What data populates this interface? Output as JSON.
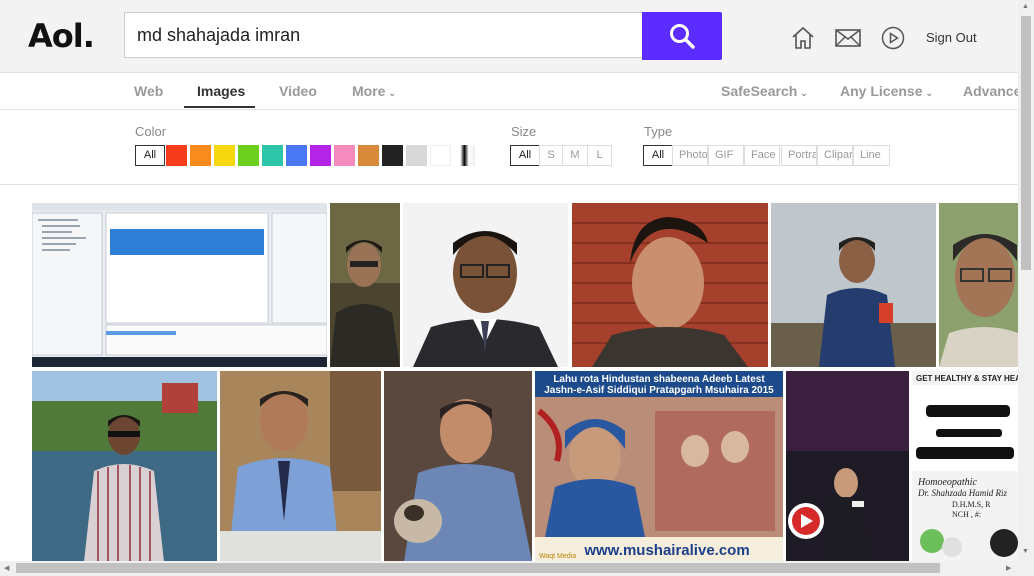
{
  "header": {
    "logo": "Aol.",
    "search_value": "md shahajada imran",
    "signout_label": "Sign Out",
    "icons": [
      "home-icon",
      "mail-icon",
      "play-icon"
    ],
    "accent_color": "#5b2bff"
  },
  "tabs": {
    "web": "Web",
    "images": "Images",
    "video": "Video",
    "more": "More",
    "safesearch": "SafeSearch",
    "license": "Any License",
    "advanced": "Advanced",
    "active": "Images"
  },
  "filters": {
    "color_label": "Color",
    "color_all": "All",
    "colors": [
      "#f53d1b",
      "#f78c1d",
      "#f5d80f",
      "#6dd01f",
      "#2ec6a8",
      "#4a78f5",
      "#b424e6",
      "#f58bbd",
      "#d88a3a",
      "#222222",
      "#d8d8d8",
      "#ffffff",
      "gradient"
    ],
    "size_label": "Size",
    "sizes": [
      "All",
      "S",
      "M",
      "L"
    ],
    "type_label": "Type",
    "types": [
      "All",
      "Photo",
      "GIF",
      "Face",
      "Portrait",
      "Clipart",
      "Line"
    ]
  },
  "results": {
    "row1": [
      "screenshot-ide",
      "man-portrait-dark",
      "man-glasses-suit",
      "man-brick-wall",
      "man-sky-jacket",
      "man-glasses-smile"
    ],
    "row2": [
      "man-lake",
      "man-blue-shirt-desk",
      "man-cat-sofa",
      "mushaira-poster",
      "man-speaker-stage",
      "homeopathic-ad"
    ],
    "mushaira_title_1": "Lahu rota Hindustan shabeena Adeeb Latest",
    "mushaira_title_2": "Jashn-e-Asif Siddiqui Pratapgarh Msuhaira 2015",
    "mushaira_url": "www.mushairalive.com",
    "mushaira_badge": "Waqt Media",
    "ad_top": "GET HEALTHY & STAY HEALTHY",
    "ad_line1": "Homoeopathic",
    "ad_line2": "Dr. Shahzada Hamid Riz",
    "ad_line3": "D.H.M.S, R",
    "ad_line4": "NCH , #:"
  }
}
